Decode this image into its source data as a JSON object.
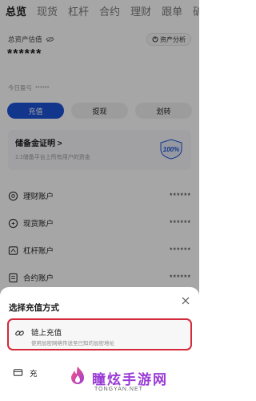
{
  "tabs": [
    "总览",
    "现货",
    "杠杆",
    "合约",
    "理财",
    "跟单",
    "矿"
  ],
  "assets": {
    "label": "总资产估值",
    "analysis_button": "资产分析",
    "balance": "******",
    "today_pnl_label": "今日盈亏",
    "today_pnl_value": "******"
  },
  "actions": {
    "deposit": "充值",
    "withdraw": "提现",
    "transfer": "划转"
  },
  "reserve": {
    "title": "储备金证明 >",
    "subtitle": "1:1储备平台上所有用户的资金",
    "badge": "100%"
  },
  "accounts": [
    {
      "name": "理财账户",
      "value": "******",
      "icon": "piggy-bank-icon"
    },
    {
      "name": "现货账户",
      "value": "******",
      "icon": "spot-coin-icon"
    },
    {
      "name": "杠杆账户",
      "value": "******",
      "icon": "leverage-icon"
    },
    {
      "name": "合约账户",
      "value": "******",
      "icon": "contract-icon"
    }
  ],
  "sheet": {
    "title": "选择充值方式",
    "option1_title": "链上充值",
    "option1_desc": "使用加密网络传送至已知的加密地址",
    "option2_title": "充"
  },
  "watermark": {
    "name": "瞳炫手游网",
    "url": "TONGYAN.NET"
  },
  "colors": {
    "primary": "#1c54d8",
    "highlight_border": "#d22a3b",
    "watermark": "#9a3bd6"
  }
}
